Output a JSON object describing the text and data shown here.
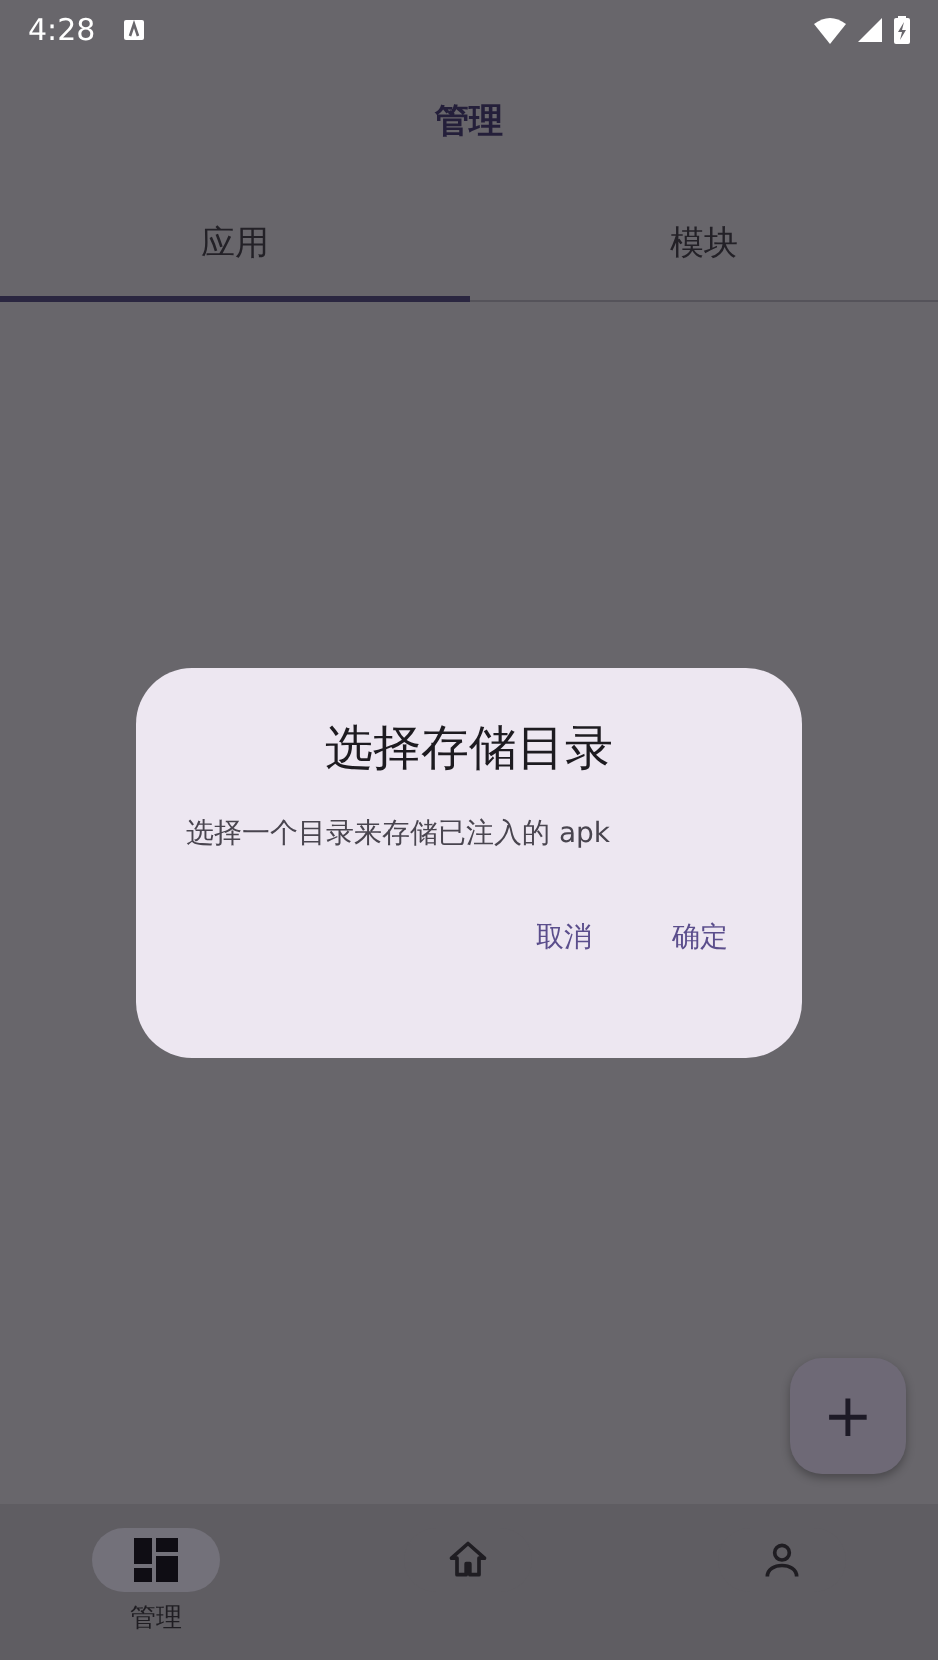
{
  "status_bar": {
    "time": "4:28"
  },
  "app_bar": {
    "title": "管理"
  },
  "tabs": [
    {
      "label": "应用",
      "selected": true
    },
    {
      "label": "模块",
      "selected": false
    }
  ],
  "dialog": {
    "title": "选择存储目录",
    "message": "选择一个目录来存储已注入的 apk",
    "buttons": [
      "取消",
      "确定"
    ]
  },
  "fab": {
    "label": "+"
  },
  "bottom_nav": [
    {
      "label": "管理",
      "selected": true
    },
    {
      "selected": false
    },
    {
      "selected": false
    }
  ]
}
